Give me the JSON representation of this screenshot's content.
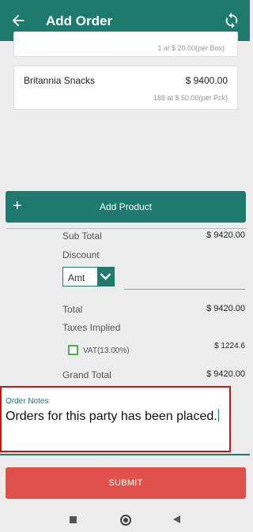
{
  "header": {
    "title": "Add Order",
    "back_icon": "arrow-left-icon",
    "sync_icon": "sync-icon",
    "color": "#1e7a6e"
  },
  "products": [
    {
      "name": "",
      "amount": "",
      "detail": "1 at $ 20.00(per Box)"
    },
    {
      "name": "Britannia Snacks",
      "amount": "$ 9400.00",
      "detail": "188 at $ 50.00(per Pck)"
    }
  ],
  "add_product": {
    "icon": "plus-icon",
    "label": "Add Product"
  },
  "summary": {
    "subtotal_label": "Sub Total",
    "subtotal_value": "$ 9420.00",
    "discount_label": "Discount",
    "discount_type": "Amt",
    "total_label": "Total",
    "total_value": "$ 9420.00",
    "taxes_label": "Taxes Implied",
    "vat_label": "VAT(13.00%)",
    "vat_value": "$ 1224.6",
    "vat_checked": false,
    "grand_total_label": "Grand Total",
    "grand_total_value": "$ 9420.00"
  },
  "notes": {
    "label": "Order Notes",
    "value": "Orders for this party has been placed."
  },
  "submit": {
    "label": "SUBMIT",
    "color": "#e05249"
  },
  "system_nav": {
    "recents_icon": "square-icon",
    "home_icon": "circle-icon",
    "back_icon": "triangle-back-icon"
  }
}
